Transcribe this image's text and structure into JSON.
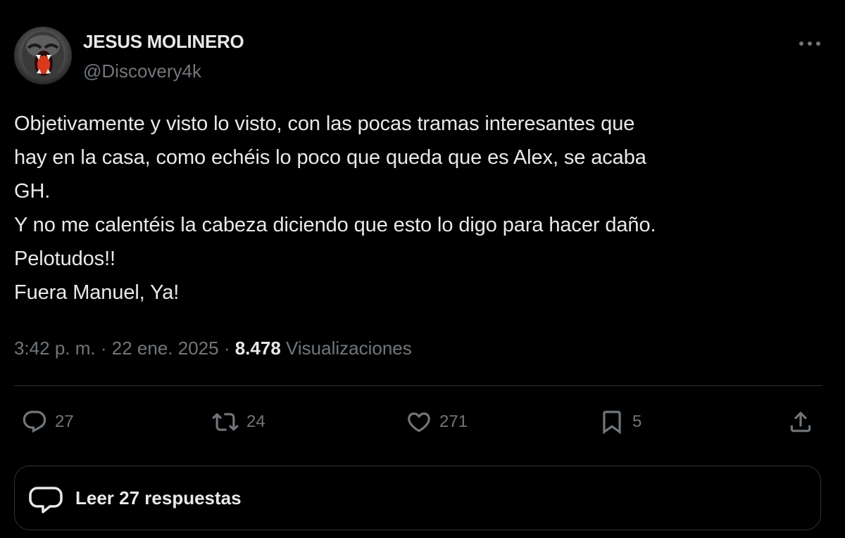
{
  "author": {
    "name": "JESUS MOLINERO",
    "handle": "@Discovery4k",
    "avatar_icon": "gorilla-avatar"
  },
  "tweet": {
    "lines": [
      "Objetivamente y visto lo visto, con las pocas tramas interesantes que",
      "hay en la casa, como echéis lo poco que queda que es Alex, se acaba",
      "GH.",
      "Y no me calentéis la cabeza diciendo que esto lo digo para hacer daño.",
      "Pelotudos!!",
      "Fuera Manuel, Ya!"
    ],
    "time": "3:42 p. m.",
    "separator": "·",
    "date": "22 ene. 2025",
    "views_count": "8.478",
    "views_label": "Visualizaciones"
  },
  "actions": {
    "replies": "27",
    "retweets": "24",
    "likes": "271",
    "bookmarks": "5"
  },
  "read_replies_label": "Leer 27 respuestas",
  "colors": {
    "background": "#000000",
    "text_primary": "#e7e9ea",
    "text_secondary": "#71767b",
    "border": "#2f3336"
  }
}
